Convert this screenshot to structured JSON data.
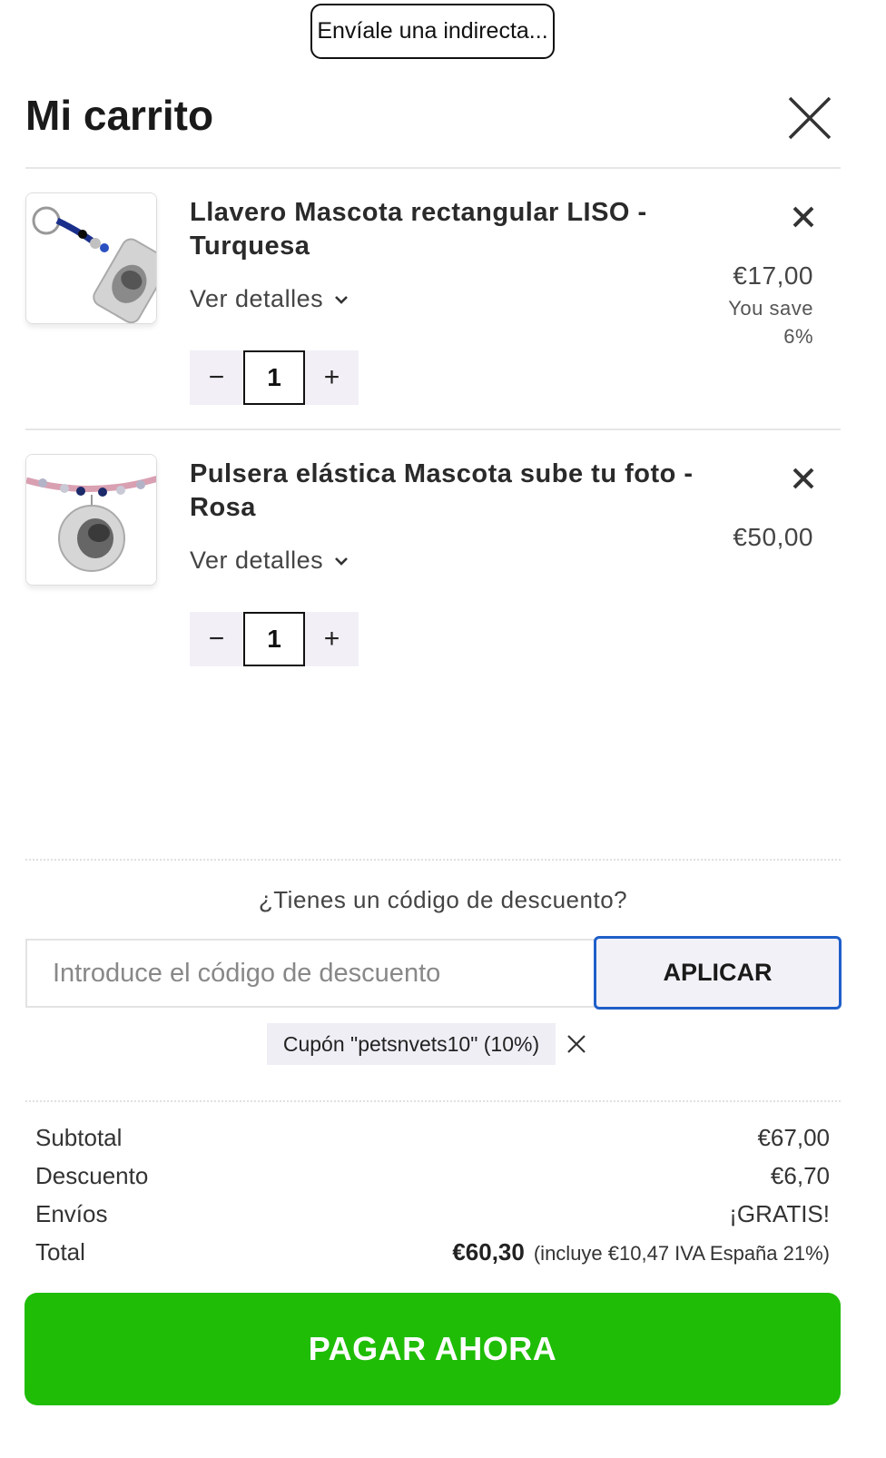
{
  "hint_button": "Envíale una indirecta...",
  "cart_title": "Mi carrito",
  "items": [
    {
      "name": "Llavero Mascota rectangular LISO - Turquesa",
      "details_label": "Ver detalles",
      "price": "€17,00",
      "save_line1": "You save",
      "save_line2": "6%",
      "quantity": "1",
      "minus": "−",
      "plus": "+"
    },
    {
      "name": "Pulsera elástica Mascota sube tu foto - Rosa",
      "details_label": "Ver detalles",
      "price": "€50,00",
      "quantity": "1",
      "minus": "−",
      "plus": "+"
    }
  ],
  "coupon": {
    "question": "¿Tienes un código de descuento?",
    "placeholder": "Introduce el código de descuento",
    "apply_label": "APLICAR",
    "applied_tag": "Cupón \"petsnvets10\" (10%)"
  },
  "summary": {
    "subtotal_label": "Subtotal",
    "subtotal_value": "€67,00",
    "discount_label": "Descuento",
    "discount_value": "€6,70",
    "shipping_label": "Envíos",
    "shipping_value": "¡GRATIS!",
    "total_label": "Total",
    "total_value": "€60,30",
    "tax_note": "(incluye €10,47 IVA España 21%)"
  },
  "pay_button": "PAGAR AHORA",
  "colors": {
    "pay_green": "#1fbd06",
    "apply_border": "#1f5fc9",
    "qty_bg": "#f2f0f6"
  }
}
